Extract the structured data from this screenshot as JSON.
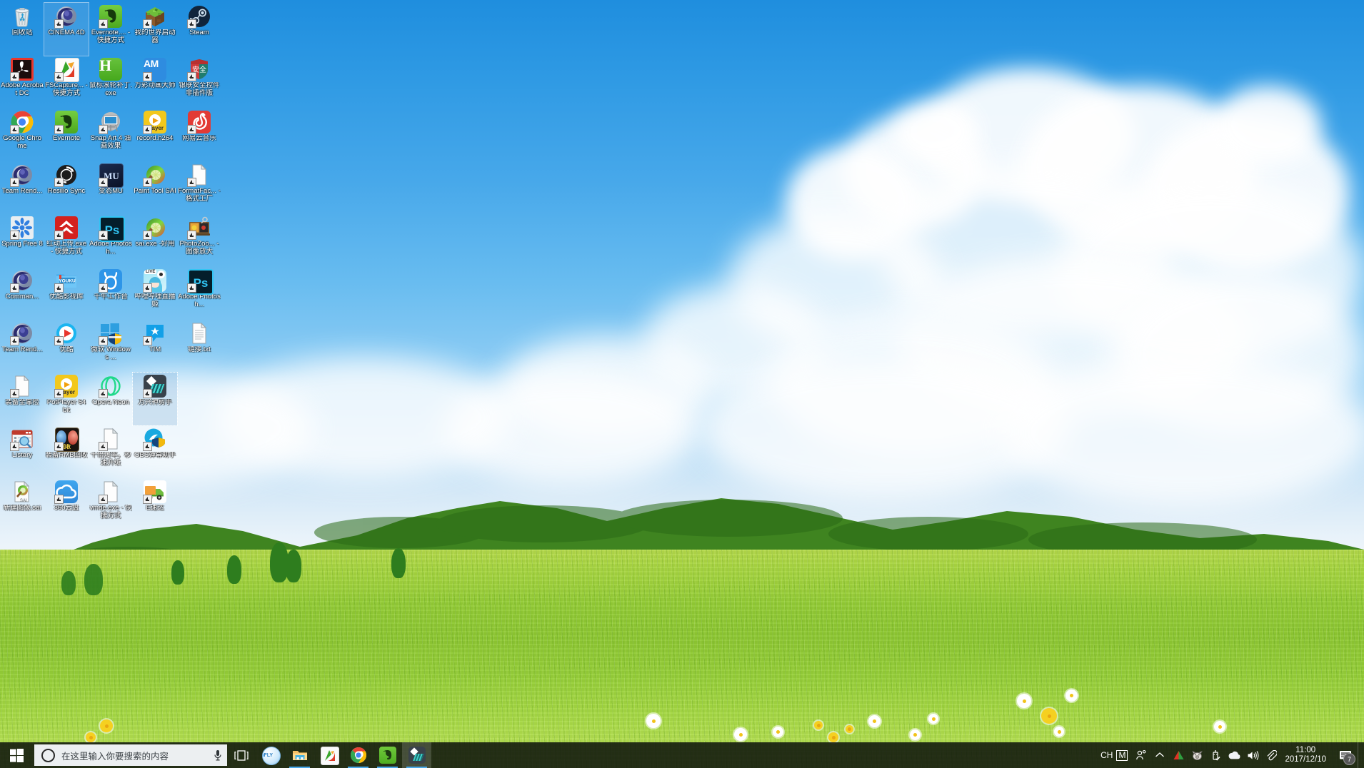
{
  "desktop": {
    "wallpaper_description": "green grassland meadow with hills, blue sky and white clouds",
    "colors": {
      "sky_top": "#1f8ede",
      "sky_bottom": "#f2f7fb",
      "grass": "#93cc35",
      "hill": "#5aa02c",
      "taskbar": "#0c120a",
      "search_field": "#eceff1",
      "accent": "#4aa8e8"
    },
    "icons": [
      {
        "label": "回收站",
        "icon": "recycle-bin-icon",
        "shortcut": false,
        "selected": false
      },
      {
        "label": "CINEMA 4D",
        "icon": "cinema4d-icon",
        "shortcut": true,
        "selected": true
      },
      {
        "label": "Evernote.... - 快捷方式",
        "icon": "evernote-icon",
        "shortcut": true,
        "selected": false
      },
      {
        "label": "我的世界启动器",
        "icon": "minecraft-icon",
        "shortcut": true,
        "selected": false
      },
      {
        "label": "Steam",
        "icon": "steam-icon",
        "shortcut": true,
        "selected": false
      },
      {
        "label": "Adobe Acrobat DC",
        "icon": "acrobat-icon",
        "shortcut": true,
        "selected": false
      },
      {
        "label": "FSCapture... - 快捷方式",
        "icon": "fscapture-icon",
        "shortcut": true,
        "selected": false
      },
      {
        "label": "鼠标滚轮补丁.exe",
        "icon": "huion-h-icon",
        "shortcut": false,
        "selected": false
      },
      {
        "label": "万彩动画大师",
        "icon": "animiz-am-icon",
        "shortcut": true,
        "selected": false
      },
      {
        "label": "银联安全控件非插件版",
        "icon": "unionpay-shield-icon",
        "shortcut": true,
        "selected": false
      },
      {
        "label": "Google Chrome",
        "icon": "chrome-icon",
        "shortcut": true,
        "selected": false
      },
      {
        "label": "Evernote",
        "icon": "evernote-icon",
        "shortcut": true,
        "selected": false
      },
      {
        "label": "Snap Art 4 油画效果",
        "icon": "snapart-easel-icon",
        "shortcut": true,
        "selected": false
      },
      {
        "label": "record.h264",
        "icon": "potplayer-icon",
        "shortcut": true,
        "selected": false
      },
      {
        "label": "网易云音乐",
        "icon": "netease-music-icon",
        "shortcut": true,
        "selected": false
      },
      {
        "label": "Team Rend...",
        "icon": "cinema4d-icon",
        "shortcut": true,
        "selected": false
      },
      {
        "label": "Resilio Sync",
        "icon": "resilio-sync-icon",
        "shortcut": true,
        "selected": false
      },
      {
        "label": "变态MU",
        "icon": "mu-game-icon",
        "shortcut": true,
        "selected": false
      },
      {
        "label": "Paint Tool SAI",
        "icon": "paint-tool-sai-icon",
        "shortcut": true,
        "selected": false
      },
      {
        "label": "FormatFac... - 格式工厂",
        "icon": "blank-document-icon",
        "shortcut": true,
        "selected": false
      },
      {
        "label": "Spring Free 8",
        "icon": "spring-free-icon",
        "shortcut": true,
        "selected": false
      },
      {
        "label": "红动上传.exe - 快捷方式",
        "icon": "redocn-upload-icon",
        "shortcut": true,
        "selected": false
      },
      {
        "label": "Adobe Photosh...",
        "icon": "photoshop-icon",
        "shortcut": true,
        "selected": false
      },
      {
        "label": "sai.exe -好用",
        "icon": "paint-tool-sai-icon",
        "shortcut": true,
        "selected": false
      },
      {
        "label": "PhotoZoo... -图像放大",
        "icon": "photozoom-icon",
        "shortcut": true,
        "selected": false
      },
      {
        "label": "Comman...",
        "icon": "cinema4d-icon",
        "shortcut": true,
        "selected": false
      },
      {
        "label": "优酷影视库",
        "icon": "youku-folder-icon",
        "shortcut": true,
        "selected": false
      },
      {
        "label": "千牛工作台",
        "icon": "qianniu-icon",
        "shortcut": true,
        "selected": false
      },
      {
        "label": "哔哩哔哩直播姬",
        "icon": "bilibili-live-icon",
        "shortcut": true,
        "selected": false
      },
      {
        "label": "Adobe Photosh...",
        "icon": "photoshop-icon",
        "shortcut": true,
        "selected": false
      },
      {
        "label": "Team Rend...",
        "icon": "cinema4d-icon",
        "shortcut": true,
        "selected": false
      },
      {
        "label": "优酷",
        "icon": "youku-player-icon",
        "shortcut": true,
        "selected": false
      },
      {
        "label": "微软 Windows ...",
        "icon": "windows-defender-icon",
        "shortcut": true,
        "selected": false
      },
      {
        "label": "TIM",
        "icon": "tim-icon",
        "shortcut": true,
        "selected": false
      },
      {
        "label": "链接.txt",
        "icon": "text-document-icon",
        "shortcut": false,
        "selected": false
      },
      {
        "label": "装备全靠捡",
        "icon": "blank-document-icon",
        "shortcut": true,
        "selected": false
      },
      {
        "label": "PotPlayer 64 bit",
        "icon": "potplayer-icon",
        "shortcut": true,
        "selected": false
      },
      {
        "label": "Opera Neon",
        "icon": "opera-neon-icon",
        "shortcut": true,
        "selected": false
      },
      {
        "label": "万兴神剪手",
        "icon": "filmora-icon",
        "shortcut": true,
        "selected": true
      },
      {
        "label": "",
        "icon": "none",
        "shortcut": false,
        "selected": false
      },
      {
        "label": "Listary",
        "icon": "listary-icon",
        "shortcut": true,
        "selected": false
      },
      {
        "label": "装备RMB回收",
        "icon": "rmb-recycle-game-icon",
        "shortcut": true,
        "selected": false
      },
      {
        "label": "十倍爆率，秒速升级",
        "icon": "blank-document-icon",
        "shortcut": true,
        "selected": false
      },
      {
        "label": "OBS弹幕助手",
        "icon": "obs-danmaku-icon",
        "shortcut": true,
        "selected": false
      },
      {
        "label": "",
        "icon": "none",
        "shortcut": false,
        "selected": false
      },
      {
        "label": "新建图像.sai",
        "icon": "sai-file-icon",
        "shortcut": false,
        "selected": false
      },
      {
        "label": "360云盘",
        "icon": "360-cloud-icon",
        "shortcut": true,
        "selected": false
      },
      {
        "label": "vmde.exe - 快捷方式",
        "icon": "blank-document-icon",
        "shortcut": true,
        "selected": false
      },
      {
        "label": "E速达",
        "icon": "esuda-truck-icon",
        "shortcut": true,
        "selected": false
      },
      {
        "label": "",
        "icon": "none",
        "shortcut": false,
        "selected": false
      }
    ]
  },
  "taskbar": {
    "start_button": "start-button",
    "search": {
      "placeholder": "在这里输入你要搜索的内容",
      "value": "",
      "cortana_icon": "cortana-circle-icon",
      "mic_icon": "microphone-icon"
    },
    "task_view": "task-view-button",
    "apps": [
      {
        "name": "iFLY",
        "icon": "ifly-icon",
        "running": false,
        "active": false
      },
      {
        "name": "文件资源管理器",
        "icon": "file-explorer-icon",
        "running": true,
        "active": false
      },
      {
        "name": "FSCapture",
        "icon": "fscapture-icon",
        "running": false,
        "active": false
      },
      {
        "name": "Google Chrome",
        "icon": "chrome-icon",
        "running": true,
        "active": false
      },
      {
        "name": "Evernote",
        "icon": "evernote-icon",
        "running": true,
        "active": false
      },
      {
        "name": "万兴神剪手",
        "icon": "filmora-icon",
        "running": true,
        "active": true
      }
    ],
    "tray": {
      "ime_language": "CH",
      "ime_mode": "M",
      "icons": [
        {
          "name": "people-icon"
        },
        {
          "name": "chevron-up-icon"
        },
        {
          "name": "green-red-triangle-icon"
        },
        {
          "name": "pig-icon"
        },
        {
          "name": "usb-safely-remove-icon"
        },
        {
          "name": "onedrive-cloud-icon"
        },
        {
          "name": "volume-speaker-icon"
        },
        {
          "name": "paperclip-icon"
        }
      ]
    },
    "clock": {
      "time": "11:00",
      "date": "2017/12/10"
    },
    "notifications": {
      "icon": "action-center-icon",
      "count": "7"
    },
    "show_desktop": "show-desktop-button"
  }
}
